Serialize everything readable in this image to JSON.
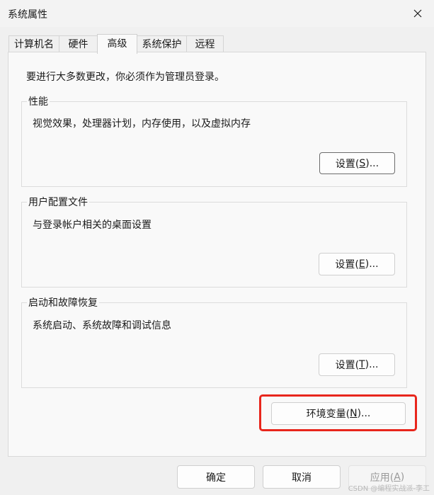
{
  "window": {
    "title": "系统属性",
    "close_icon": "close-icon"
  },
  "tabs": [
    {
      "label": "计算机名"
    },
    {
      "label": "硬件"
    },
    {
      "label": "高级",
      "active": true
    },
    {
      "label": "系统保护"
    },
    {
      "label": "远程"
    }
  ],
  "admin_note": "要进行大多数更改，你必须作为管理员登录。",
  "groups": {
    "performance": {
      "title": "性能",
      "description": "视觉效果，处理器计划，内存使用，以及虚拟内存",
      "button": {
        "text": "设置(",
        "key": "S",
        "suffix": ")..."
      }
    },
    "user_profiles": {
      "title": "用户配置文件",
      "description": "与登录帐户相关的桌面设置",
      "button": {
        "text": "设置(",
        "key": "E",
        "suffix": ")..."
      }
    },
    "startup_recovery": {
      "title": "启动和故障恢复",
      "description": "系统启动、系统故障和调试信息",
      "button": {
        "text": "设置(",
        "key": "T",
        "suffix": ")..."
      }
    }
  },
  "env_button": {
    "text": "环境变量(",
    "key": "N",
    "suffix": ")..."
  },
  "footer": {
    "ok": "确定",
    "cancel": "取消",
    "apply": {
      "text": "应用(",
      "key": "A",
      "suffix": ")"
    }
  },
  "watermark": "CSDN @编程实战派-李工",
  "colors": {
    "highlight": "#e8261c",
    "background": "#f0f0f0"
  }
}
